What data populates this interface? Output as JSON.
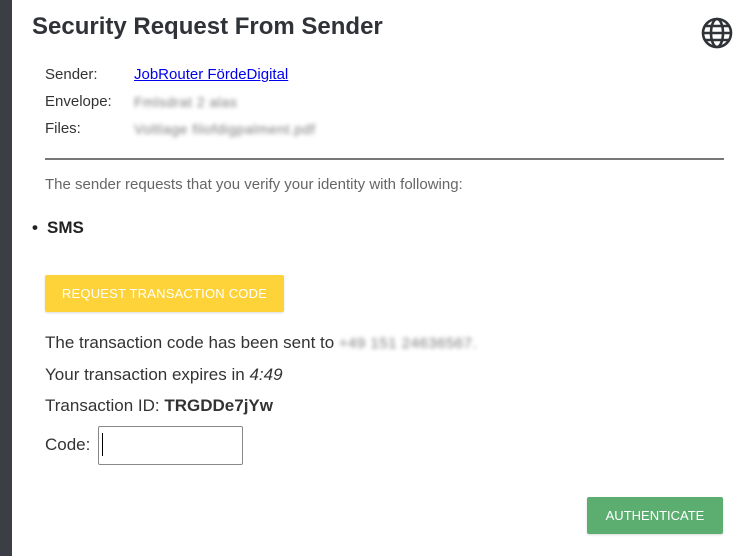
{
  "dialog": {
    "title": "Security Request From Sender",
    "language_icon": "globe-icon"
  },
  "meta": {
    "sender_label": "Sender:",
    "sender_value": "JobRouter FördeDigital",
    "envelope_label": "Envelope:",
    "envelope_value": "Fmlsdrat 2 alas",
    "files_label": "Files:",
    "files_value": "Voltlage filofdigpalment.pdf"
  },
  "verification": {
    "intro": "The sender requests that you verify your identity with following:",
    "methods": [
      "SMS"
    ]
  },
  "actions": {
    "request_code_label": "REQUEST TRANSACTION CODE",
    "authenticate_label": "AUTHENTICATE"
  },
  "transaction": {
    "sent_to_prefix": "The transaction code has been sent to ",
    "phone_masked": "+49 151 24636567.",
    "expires_prefix": "Your transaction expires in ",
    "expires_time": "4:49",
    "id_prefix": "Transaction ID: ",
    "id_value": "TRGDDe7jYw"
  },
  "code": {
    "label": "Code:",
    "value": ""
  },
  "colors": {
    "accent_yellow": "#fed33a",
    "accent_green": "#5cae70",
    "link": "#0000ee",
    "left_strip": "#3b3e45"
  }
}
